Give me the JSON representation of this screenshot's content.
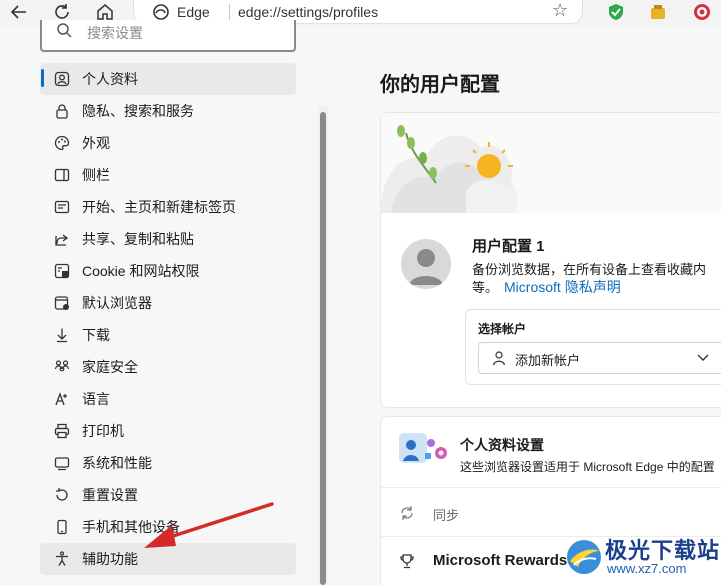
{
  "toolbar": {
    "site_label": "Edge",
    "url": "edge://settings/profiles"
  },
  "sidebar": {
    "search_placeholder": "搜索设置",
    "items": [
      {
        "label": "个人资料",
        "icon": "profile-icon"
      },
      {
        "label": "隐私、搜索和服务",
        "icon": "lock-icon"
      },
      {
        "label": "外观",
        "icon": "palette-icon"
      },
      {
        "label": "侧栏",
        "icon": "sidebar-icon"
      },
      {
        "label": "开始、主页和新建标签页",
        "icon": "home-tabs-icon"
      },
      {
        "label": "共享、复制和粘贴",
        "icon": "share-icon"
      },
      {
        "label": "Cookie 和网站权限",
        "icon": "cookie-icon"
      },
      {
        "label": "默认浏览器",
        "icon": "browser-icon"
      },
      {
        "label": "下载",
        "icon": "download-icon"
      },
      {
        "label": "家庭安全",
        "icon": "family-icon"
      },
      {
        "label": "语言",
        "icon": "language-icon"
      },
      {
        "label": "打印机",
        "icon": "printer-icon"
      },
      {
        "label": "系统和性能",
        "icon": "system-icon"
      },
      {
        "label": "重置设置",
        "icon": "reset-icon"
      },
      {
        "label": "手机和其他设备",
        "icon": "phone-icon"
      },
      {
        "label": "辅助功能",
        "icon": "accessibility-icon"
      }
    ]
  },
  "main": {
    "title": "你的用户配置",
    "profile": {
      "name": "用户配置 1",
      "desc_line1": "备份浏览数据，在所有设备上查看收藏内",
      "desc_line2": "等。",
      "privacy_link": "Microsoft 隐私声明"
    },
    "account": {
      "label": "选择帐户",
      "value": "添加新帐户"
    },
    "settings_card": {
      "title": "个人资料设置",
      "subtitle": "这些浏览器设置适用于 Microsoft Edge 中的配置",
      "sync_label": "同步",
      "rewards_label": "Microsoft Rewards"
    }
  },
  "watermark": {
    "text": "极光下载站",
    "url": "www.xz7.com"
  },
  "colors": {
    "accent": "#0f6cbd",
    "arrow": "#d42a2a"
  }
}
